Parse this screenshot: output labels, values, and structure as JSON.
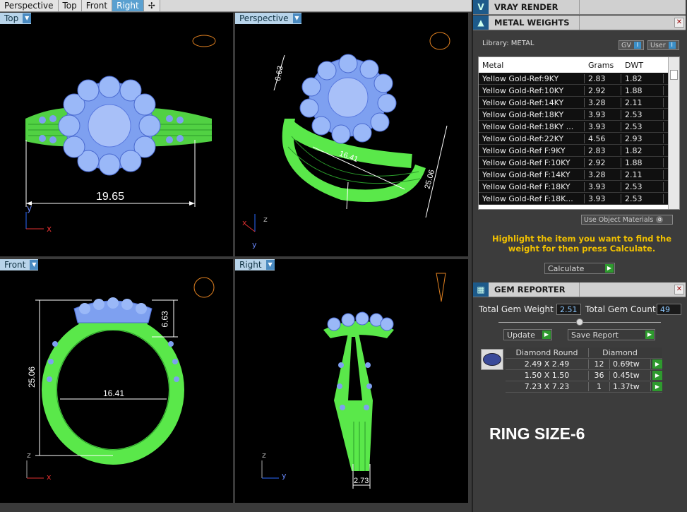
{
  "tabs": [
    "Perspective",
    "Top",
    "Front",
    "Right"
  ],
  "active_tab": "Right",
  "viewports": {
    "top": {
      "label": "Top",
      "dims": {
        "width": "19.65"
      }
    },
    "perspective": {
      "label": "Perspective",
      "dims": {
        "a": "6.63",
        "b": "16.41",
        "c": "25.06"
      }
    },
    "front": {
      "label": "Front",
      "dims": {
        "height": "25.06",
        "inner": "16.41",
        "head": "6.63"
      }
    },
    "right": {
      "label": "Right",
      "dims": {
        "shank": "2.73"
      }
    }
  },
  "axes": {
    "x": "x",
    "y": "y",
    "z": "z"
  },
  "vray": {
    "title": "VRAY RENDER"
  },
  "metal": {
    "title": "METAL WEIGHTS",
    "library": "Library: METAL",
    "gv": "GV",
    "user": "User",
    "columns": [
      "Metal",
      "Grams",
      "DWT"
    ],
    "rows": [
      [
        "Yellow Gold-Ref:9KY",
        "2.83",
        "1.82"
      ],
      [
        "Yellow Gold-Ref:10KY",
        "2.92",
        "1.88"
      ],
      [
        "Yellow Gold-Ref:14KY",
        "3.28",
        "2.11"
      ],
      [
        "Yellow Gold-Ref:18KY",
        "3.93",
        "2.53"
      ],
      [
        "Yellow Gold-Ref:18KY ...",
        "3.93",
        "2.53"
      ],
      [
        "Yellow Gold-Ref:22KY",
        "4.56",
        "2.93"
      ],
      [
        "Yellow Gold-Ref F:9KY",
        "2.83",
        "1.82"
      ],
      [
        "Yellow Gold-Ref F:10KY",
        "2.92",
        "1.88"
      ],
      [
        "Yellow Gold-Ref F:14KY",
        "3.28",
        "2.11"
      ],
      [
        "Yellow Gold-Ref F:18KY",
        "3.93",
        "2.53"
      ],
      [
        "Yellow Gold-Ref F:18K...",
        "3.93",
        "2.53"
      ]
    ],
    "use_object_materials": "Use Object Materials",
    "hint": "Highlight the item you want to find the weight for then press Calculate.",
    "calculate": "Calculate"
  },
  "gem": {
    "title": "GEM REPORTER",
    "total_weight_label": "Total Gem Weight",
    "total_weight": "2.51",
    "total_count_label": "Total Gem Count",
    "total_count": "49",
    "update": "Update",
    "save_report": "Save Report",
    "columns": [
      "Diamond Round",
      "Diamond"
    ],
    "rows": [
      [
        "2.49 X 2.49",
        "12",
        "0.69tw"
      ],
      [
        "1.50 X 1.50",
        "36",
        "0.45tw"
      ],
      [
        "7.23 X 7.23",
        "1",
        "1.37tw"
      ]
    ]
  },
  "ring_size": "RING SIZE-6",
  "colors": {
    "wire_green": "#5ae84a",
    "gem_blue": "#7ea0f0",
    "dim_white": "#ffffff",
    "hint_yellow": "#f0c000"
  }
}
